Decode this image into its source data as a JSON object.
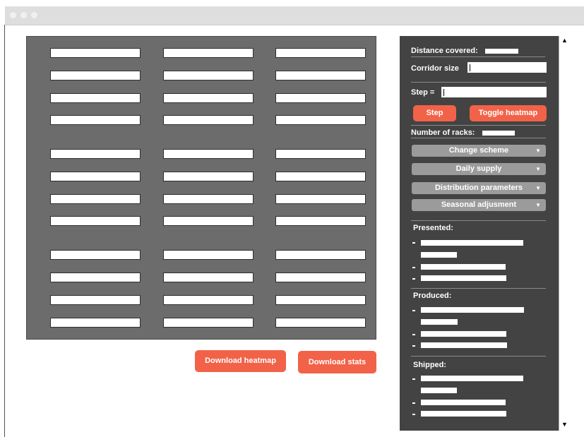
{
  "window": {
    "dots": [
      "dot-1",
      "dot-2",
      "dot-3"
    ]
  },
  "actions": {
    "download_heatmap": "Download heatmap",
    "download_stats": "Download stats"
  },
  "sidebar": {
    "distance_label": "Distance covered:",
    "corridor_label": "Corridor size",
    "step_eq_label": "Step =",
    "step_button": "Step",
    "toggle_heatmap_button": "Toggle heatmap",
    "racks_label": "Number of racks:",
    "dropdowns": [
      "Change scheme",
      "Daily supply",
      "Distribution parameters",
      "Seasonal adjusment"
    ],
    "caret_icon": "▼",
    "sections": [
      {
        "title": "Presented:"
      },
      {
        "title": "Produced:"
      },
      {
        "title": "Shipped:"
      }
    ]
  },
  "scrollbar": {
    "up": "▲",
    "down": "▼"
  },
  "colors": {
    "accent": "#f26248",
    "panel": "#434343",
    "map": "#6c6c6c",
    "dropdown": "#9b9b9b"
  }
}
